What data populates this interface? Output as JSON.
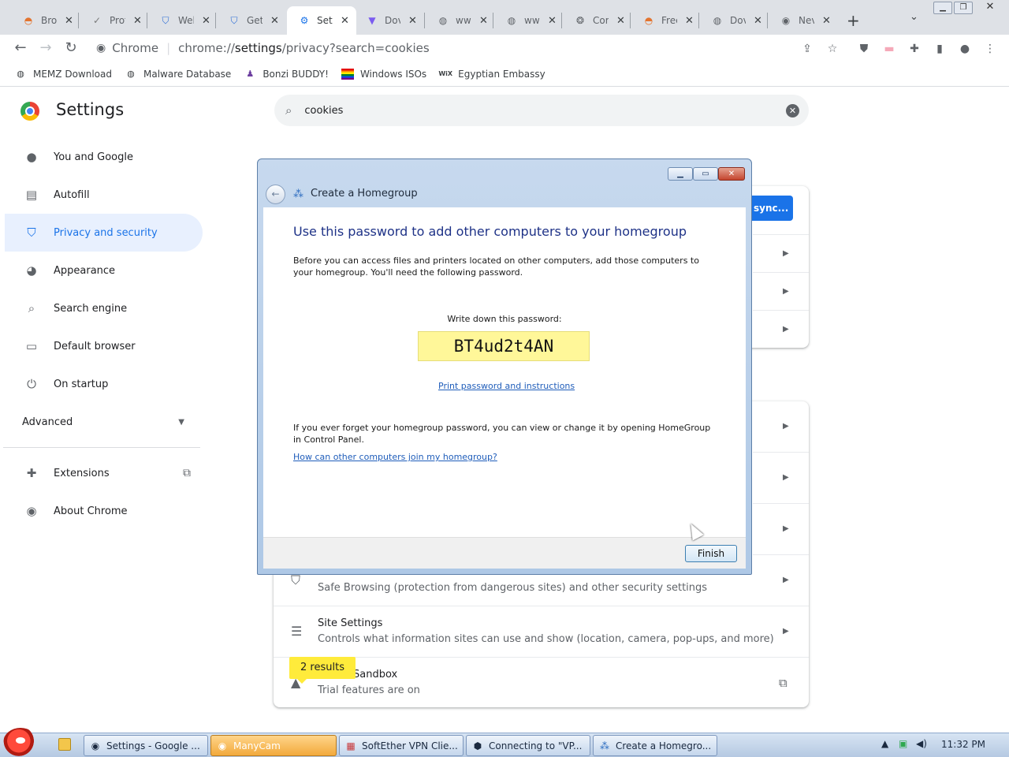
{
  "browser": {
    "tabs": [
      {
        "label": "Brow",
        "icon": "favicon-icon",
        "active": false
      },
      {
        "label": "Prot",
        "icon": "favicon-icon",
        "active": false
      },
      {
        "label": "Wel",
        "icon": "shield-icon",
        "active": false
      },
      {
        "label": "Get",
        "icon": "shield-icon",
        "active": false
      },
      {
        "label": "Sett",
        "icon": "gear-icon",
        "active": true
      },
      {
        "label": "Dov",
        "icon": "favicon-icon",
        "active": false
      },
      {
        "label": "ww",
        "icon": "globe-icon",
        "active": false
      },
      {
        "label": "ww",
        "icon": "globe-icon",
        "active": false
      },
      {
        "label": "Cor",
        "icon": "favicon-icon",
        "active": false
      },
      {
        "label": "Free",
        "icon": "favicon-icon",
        "active": false
      },
      {
        "label": "Dov",
        "icon": "globe-icon",
        "active": false
      },
      {
        "label": "Nev",
        "icon": "chrome-icon",
        "active": false
      }
    ],
    "omnibox": {
      "site_label": "Chrome",
      "url_prefix": "chrome://",
      "url_host": "settings",
      "url_rest": "/privacy?search=cookies"
    },
    "bookmarks": [
      {
        "label": "MEMZ Download"
      },
      {
        "label": "Malware Database"
      },
      {
        "label": "Bonzi BUDDY!"
      },
      {
        "label": "Windows ISOs"
      },
      {
        "label": "Egyptian Embassy"
      }
    ]
  },
  "settings": {
    "title": "Settings",
    "search_value": "cookies",
    "nav": [
      {
        "label": "You and Google",
        "icon": "person-icon"
      },
      {
        "label": "Autofill",
        "icon": "clipboard-icon"
      },
      {
        "label": "Privacy and security",
        "icon": "shield-icon",
        "active": true
      },
      {
        "label": "Appearance",
        "icon": "palette-icon"
      },
      {
        "label": "Search engine",
        "icon": "search-icon"
      },
      {
        "label": "Default browser",
        "icon": "browser-icon"
      },
      {
        "label": "On startup",
        "icon": "power-icon"
      }
    ],
    "advanced_label": "Advanced",
    "extensions_label": "Extensions",
    "about_label": "About Chrome",
    "sync_button": "sync...",
    "rows": [
      {
        "title": "",
        "subtitle": "Safe Browsing (protection from dangerous sites) and other security settings"
      },
      {
        "title": "Site Settings",
        "subtitle": "Controls what information sites can use and show (location, camera, pop-ups, and more)"
      },
      {
        "title": "Sandbox",
        "subtitle": "Trial features are on"
      }
    ],
    "results_bubble": "2 results"
  },
  "dialog": {
    "title": "Create a Homegroup",
    "heading": "Use this password to add other computers to your homegroup",
    "intro": "Before you can access files and printers located on other computers, add those computers to your homegroup. You'll need the following password.",
    "password_label": "Write down this password:",
    "password": "BT4ud2t4AN",
    "print_link": "Print password and instructions",
    "forget_text": "If you ever forget your homegroup password, you can view or change it by opening HomeGroup in Control Panel.",
    "help_link": "How can other computers join my homegroup?",
    "finish_button": "Finish"
  },
  "taskbar": {
    "tasks": [
      {
        "label": "Settings - Google ...",
        "icon": "chrome-icon",
        "active": false
      },
      {
        "label": "ManyCam",
        "icon": "chrome-icon",
        "active": true
      },
      {
        "label": "SoftEther VPN Clie...",
        "icon": "vpn-icon",
        "active": false
      },
      {
        "label": "Connecting to \"VP...",
        "icon": "network-icon",
        "active": false
      },
      {
        "label": "Create a Homegro...",
        "icon": "homegroup-icon",
        "active": false
      }
    ],
    "clock": "11:32 PM"
  },
  "colors": {
    "accent": "#1a73e8",
    "active_nav_bg": "#e8f0fe",
    "password_bg": "#fff799",
    "bubble": "#ffeb3b"
  }
}
